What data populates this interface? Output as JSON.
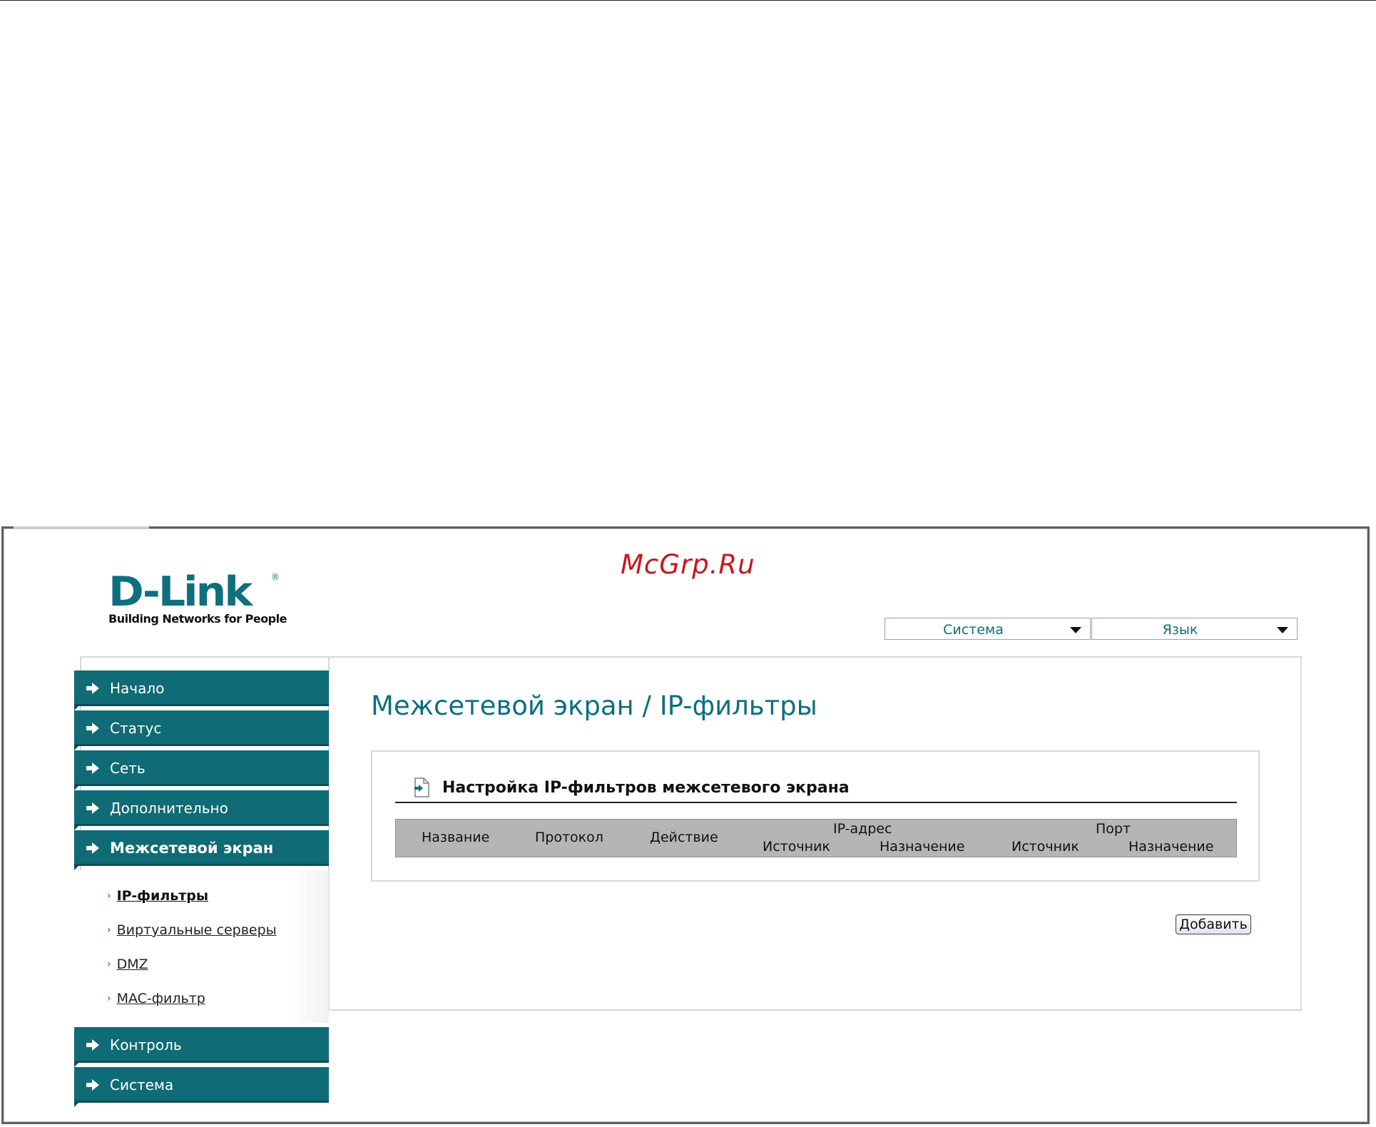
{
  "watermark": "McGrp.Ru",
  "logo": {
    "brand": "D-Link",
    "registered": "®",
    "tagline": "Building Networks for People"
  },
  "top_menu": [
    {
      "label": "Система",
      "icon": "chevron-down-icon"
    },
    {
      "label": "Язык",
      "icon": "chevron-down-icon"
    }
  ],
  "sidebar": {
    "items": [
      {
        "label": "Начало",
        "icon": "arrow-right-icon"
      },
      {
        "label": "Статус",
        "icon": "arrow-right-icon"
      },
      {
        "label": "Сеть",
        "icon": "arrow-right-icon"
      },
      {
        "label": "Дополнительно",
        "icon": "arrow-right-icon"
      },
      {
        "label": "Межсетевой экран",
        "icon": "arrow-right-icon",
        "active": true
      }
    ],
    "subitems": [
      {
        "label": "IP-фильтры",
        "active": true
      },
      {
        "label": "Виртуальные серверы"
      },
      {
        "label": "DMZ"
      },
      {
        "label": "MAC-фильтр"
      }
    ],
    "items_after": [
      {
        "label": "Контроль",
        "icon": "arrow-right-icon"
      },
      {
        "label": "Система",
        "icon": "arrow-right-icon"
      }
    ]
  },
  "main": {
    "title": "Межсетевой экран / IP-фильтры",
    "panel": {
      "title": "Настройка IP-фильтров межсетевого экрана",
      "icon": "document-arrow-icon",
      "columns": {
        "name": "Название",
        "protocol": "Протокол",
        "action": "Действие",
        "ip_group": "IP-адрес",
        "ip_source": "Источник",
        "ip_destination": "Назначение",
        "port_group": "Порт",
        "port_source": "Источник",
        "port_destination": "Назначение"
      },
      "rows": []
    },
    "add_button": "Добавить"
  }
}
